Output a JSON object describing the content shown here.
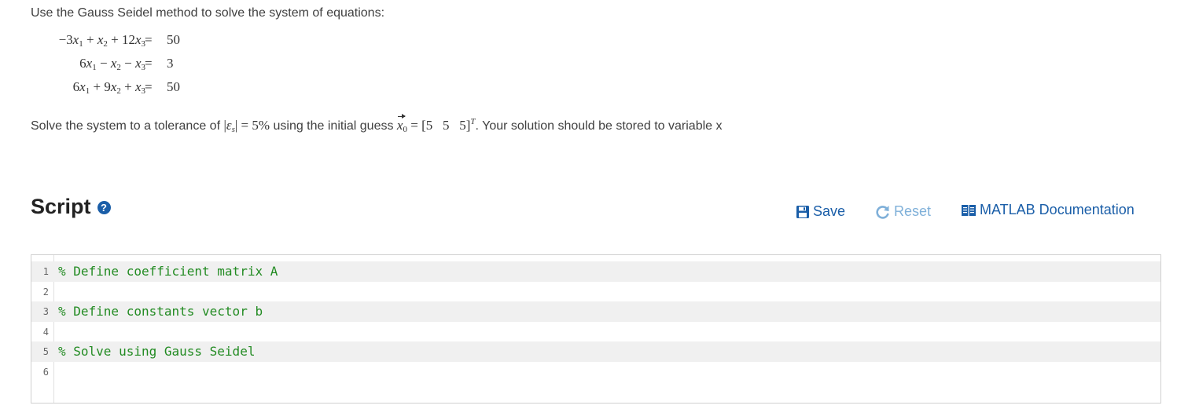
{
  "problem": {
    "intro": "Use the Gauss Seidel method to solve the system of equations:",
    "equations": [
      {
        "c1": "−3",
        "op1": "+",
        "c2": "",
        "op2": "+",
        "c3": "12",
        "rhs": "50"
      },
      {
        "c1": "6",
        "op1": "−",
        "c2": "",
        "op2": "−",
        "c3": "",
        "rhs": "3"
      },
      {
        "c1": "6",
        "op1": "+",
        "c2": "9",
        "op2": "+",
        "c3": "",
        "rhs": "50"
      }
    ],
    "eq_sign": "=",
    "tolerance_prefix": "Solve the system to a tolerance of",
    "tolerance_value": "5%",
    "guess_text": "using the initial guess",
    "guess_values": "[5   5   5]",
    "suffix": ". Your solution should be stored to variable x"
  },
  "script": {
    "heading": "Script",
    "help_icon": "question-circle-icon",
    "save_label": "Save",
    "reset_label": "Reset",
    "doc_label": "MATLAB Documentation"
  },
  "editor": {
    "lines": [
      {
        "num": "1",
        "text": "% Define coefficient matrix A"
      },
      {
        "num": "2",
        "text": ""
      },
      {
        "num": "3",
        "text": "% Define constants vector b"
      },
      {
        "num": "4",
        "text": ""
      },
      {
        "num": "5",
        "text": "% Solve using Gauss Seidel"
      },
      {
        "num": "6",
        "text": ""
      }
    ]
  },
  "colors": {
    "link": "#1a5ea8",
    "disabled_link": "#7fb0d9",
    "comment": "#228b22",
    "shaded_line": "#f0f0f0"
  }
}
